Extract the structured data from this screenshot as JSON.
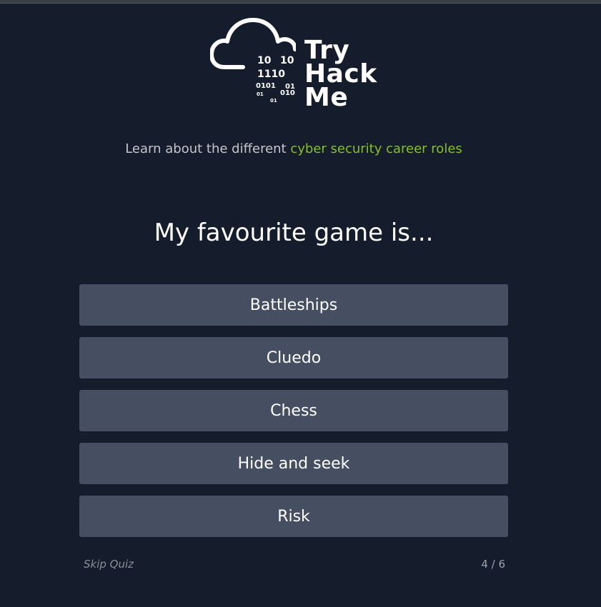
{
  "logo": {
    "binary_lines": [
      "10",
      "10",
      "1110",
      "0101",
      "01",
      "01",
      "010",
      "01"
    ],
    "wordmark": [
      "Try",
      "Hack",
      "Me"
    ]
  },
  "tagline": {
    "prefix": "Learn about the different ",
    "link": "cyber security career roles"
  },
  "question": "My favourite game is...",
  "answers": [
    "Battleships",
    "Cluedo",
    "Chess",
    "Hide and seek",
    "Risk"
  ],
  "footer": {
    "skip_label": "Skip Quiz",
    "progress": "4 / 6"
  },
  "colors": {
    "background": "#151c2b",
    "button": "#464f62",
    "accent": "#86bf2c",
    "text": "#ffffff"
  },
  "icons": [
    "cloud-icon"
  ]
}
